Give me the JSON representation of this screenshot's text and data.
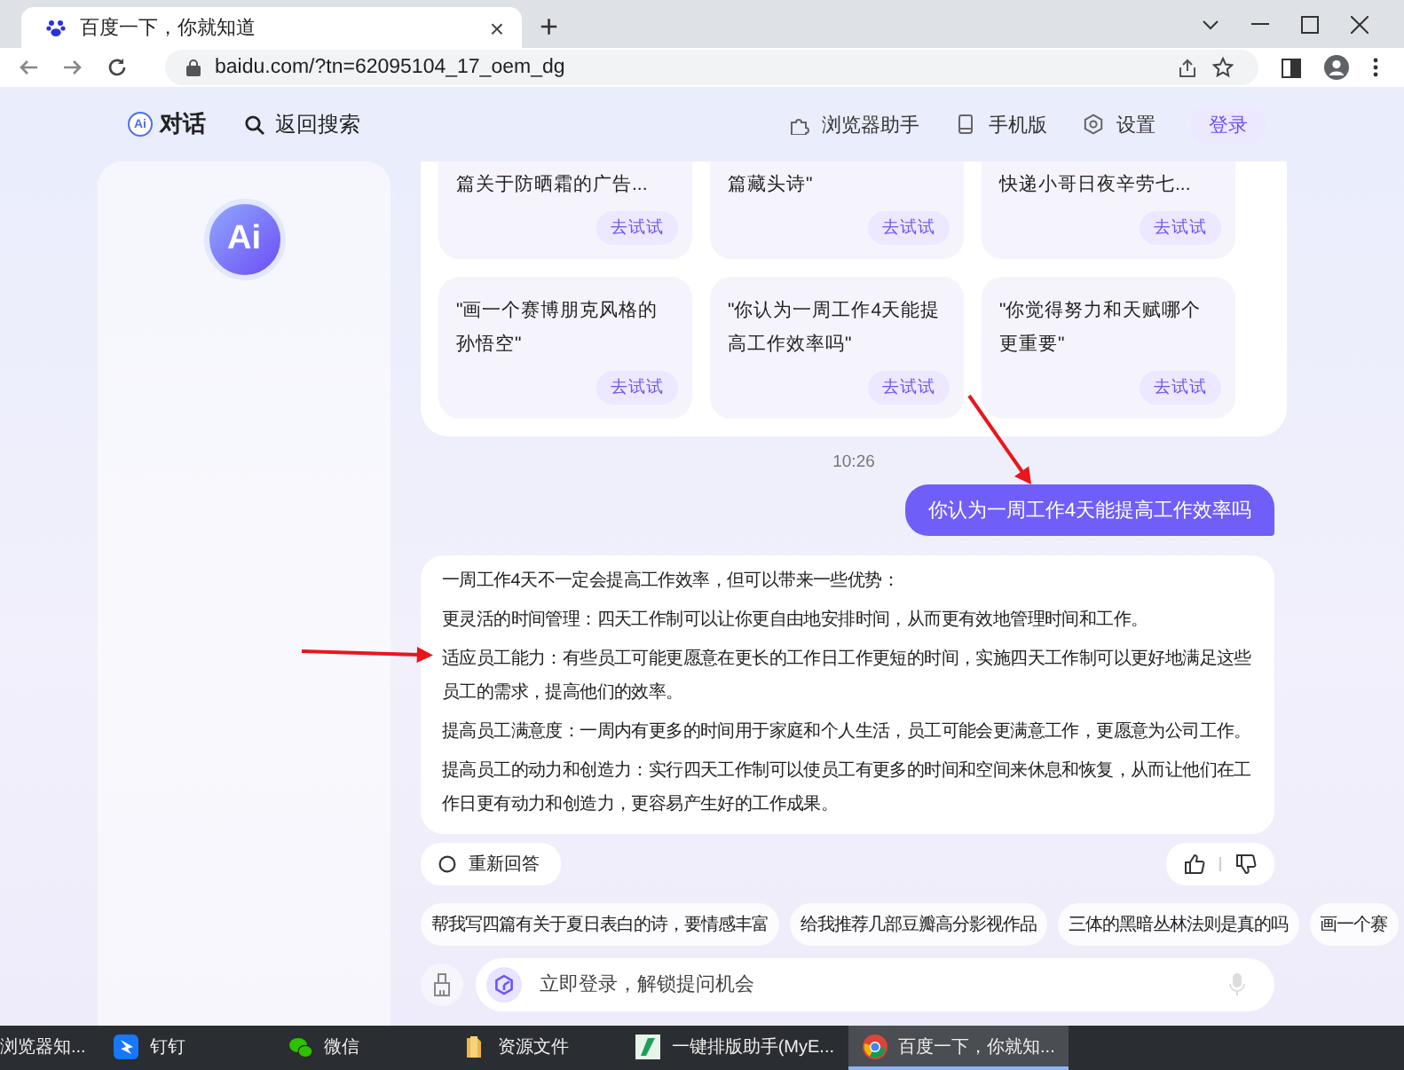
{
  "browser": {
    "tab": {
      "title": "百度一下，你就知道",
      "close": "×"
    },
    "new_tab": "+",
    "url": "baidu.com/?tn=62095104_17_oem_dg"
  },
  "header": {
    "logo": "Ai",
    "brand": "对话",
    "back": "返回搜索",
    "links": [
      {
        "label": "浏览器助手"
      },
      {
        "label": "手机版"
      },
      {
        "label": "设置"
      }
    ],
    "login": "登录"
  },
  "side": {
    "logo": "Ai"
  },
  "suggestion_cards": [
    {
      "lines": [
        "篇关于防晒霜的广告..."
      ],
      "button": "去试试"
    },
    {
      "lines": [
        "篇藏头诗\""
      ],
      "button": "去试试"
    },
    {
      "lines": [
        "快递小哥日夜辛劳七..."
      ],
      "button": "去试试"
    },
    {
      "lines": [
        "\"画一个赛博朋克风格的",
        "孙悟空\""
      ],
      "button": "去试试"
    },
    {
      "lines": [
        "\"你认为一周工作4天能提",
        "高工作效率吗\""
      ],
      "button": "去试试"
    },
    {
      "lines": [
        "\"你觉得努力和天赋哪个",
        "更重要\""
      ],
      "button": "去试试"
    }
  ],
  "time": "10:26",
  "user_message": "你认为一周工作4天能提高工作效率吗",
  "answer": {
    "paragraphs": [
      "一周工作4天不一定会提高工作效率，但可以带来一些优势：",
      "更灵活的时间管理：四天工作制可以让你更自由地安排时间，从而更有效地管理时间和工作。",
      "适应员工能力：有些员工可能更愿意在更长的工作日工作更短的时间，实施四天工作制可以更好地满足这些员工的需求，提高他们的效率。",
      "提高员工满意度：一周内有更多的时间用于家庭和个人生活，员工可能会更满意工作，更愿意为公司工作。",
      "提高员工的动力和创造力：实行四天工作制可以使员工有更多的时间和空间来休息和恢复，从而让他们在工作日更有动力和创造力，更容易产生好的工作成果。"
    ]
  },
  "regenerate": "重新回答",
  "chips": [
    "帮我写四篇有关于夏日表白的诗，要情感丰富",
    "给我推荐几部豆瓣高分影视作品",
    "三体的黑暗丛林法则是真的吗",
    "画一个赛"
  ],
  "input": {
    "placeholder": "立即登录，解锁提问机会"
  },
  "taskbar": {
    "items": [
      {
        "label": "浏览器知...",
        "selected": false
      },
      {
        "label": "钉钉",
        "selected": false
      },
      {
        "label": "微信",
        "selected": false
      },
      {
        "label": "资源文件",
        "selected": false
      },
      {
        "label": "一键排版助手(MyE...",
        "selected": false
      },
      {
        "label": "百度一下，你就知...",
        "selected": true
      }
    ]
  }
}
